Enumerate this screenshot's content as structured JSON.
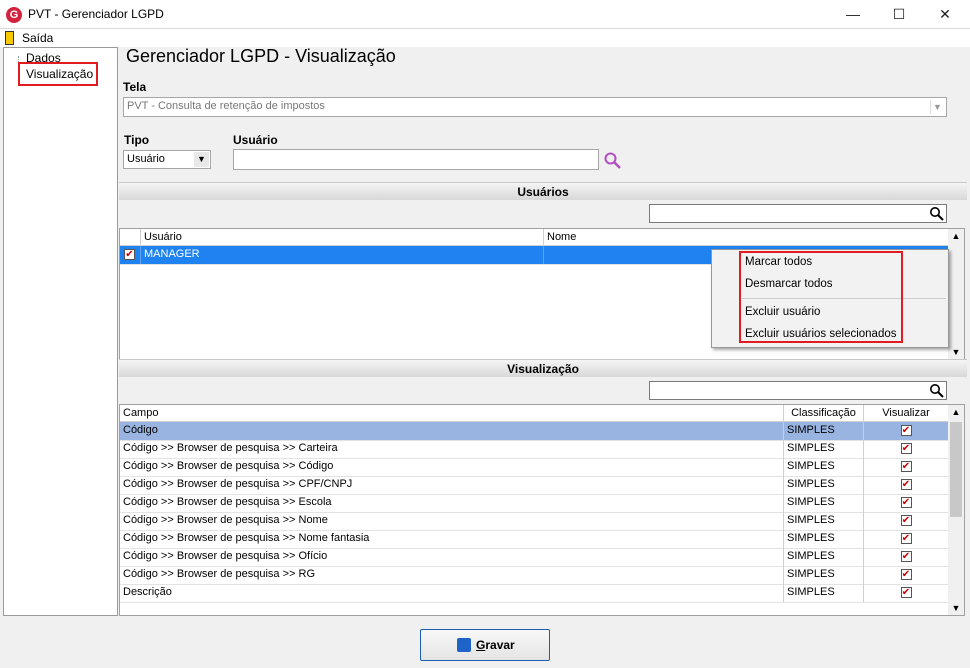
{
  "window": {
    "title": "PVT - Gerenciador LGPD",
    "logo": "G"
  },
  "menu": {
    "exit_label": "Saída"
  },
  "tree": {
    "items": [
      "Dados",
      "Visualização"
    ]
  },
  "page": {
    "title": "Gerenciador LGPD - Visualização"
  },
  "tela": {
    "label": "Tela",
    "value": "PVT - Consulta de retenção de impostos"
  },
  "tipo": {
    "label": "Tipo",
    "value": "Usuário"
  },
  "usuario": {
    "label": "Usuário",
    "value": ""
  },
  "users_section": {
    "title": "Usuários",
    "columns": [
      "Usuário",
      "Nome"
    ],
    "rows": [
      {
        "usuario": "MANAGER",
        "nome": "",
        "checked": true
      }
    ]
  },
  "context_menu": {
    "items": [
      "Marcar todos",
      "Desmarcar todos",
      "Excluir usuário",
      "Excluir usuários selecionados"
    ]
  },
  "vis_section": {
    "title": "Visualização",
    "columns": [
      "Campo",
      "Classificação",
      "Visualizar"
    ],
    "rows": [
      {
        "campo": "Código",
        "classificacao": "SIMPLES",
        "visualizar": true
      },
      {
        "campo": "Código >> Browser de pesquisa >> Carteira",
        "classificacao": "SIMPLES",
        "visualizar": true
      },
      {
        "campo": "Código >> Browser de pesquisa >> Código",
        "classificacao": "SIMPLES",
        "visualizar": true
      },
      {
        "campo": "Código >> Browser de pesquisa >> CPF/CNPJ",
        "classificacao": "SIMPLES",
        "visualizar": true
      },
      {
        "campo": "Código >> Browser de pesquisa >> Escola",
        "classificacao": "SIMPLES",
        "visualizar": true
      },
      {
        "campo": "Código >> Browser de pesquisa >> Nome",
        "classificacao": "SIMPLES",
        "visualizar": true
      },
      {
        "campo": "Código >> Browser de pesquisa >> Nome fantasia",
        "classificacao": "SIMPLES",
        "visualizar": true
      },
      {
        "campo": "Código >> Browser de pesquisa >> Ofício",
        "classificacao": "SIMPLES",
        "visualizar": true
      },
      {
        "campo": "Código >> Browser de pesquisa >> RG",
        "classificacao": "SIMPLES",
        "visualizar": true
      },
      {
        "campo": "Descrição",
        "classificacao": "SIMPLES",
        "visualizar": true
      }
    ]
  },
  "actions": {
    "save_label": "Gravar",
    "save_accel": "G",
    "save_rest": "ravar"
  },
  "colors": {
    "selection": "#1e82f0",
    "highlight_row": "#99b4e1",
    "annotation": "#e11b22"
  }
}
